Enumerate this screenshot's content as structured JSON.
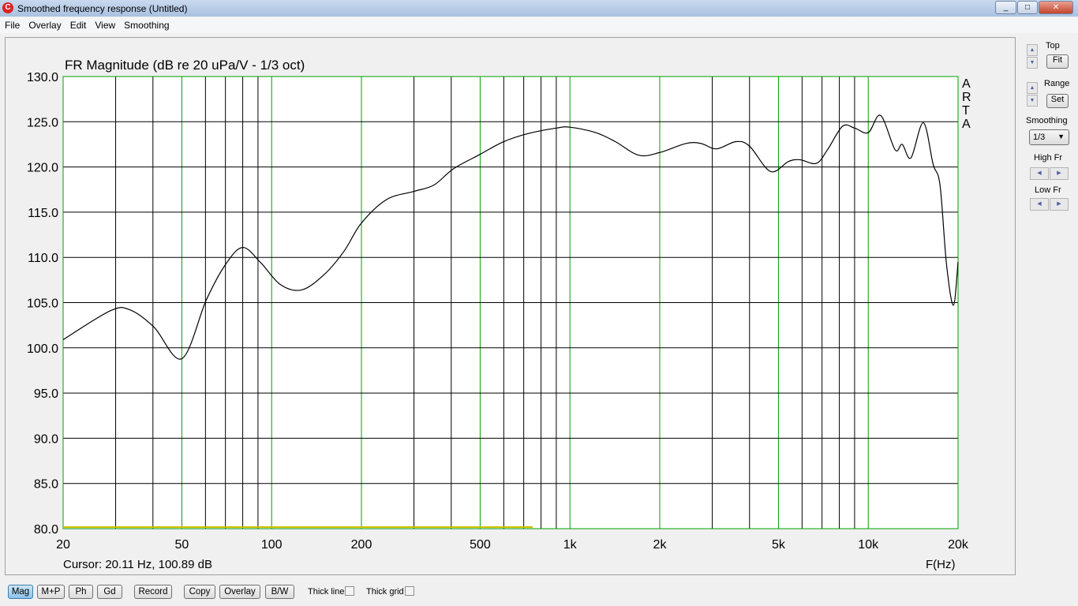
{
  "window": {
    "title": "Smoothed frequency response (Untitled)",
    "controls": [
      "_",
      "□",
      "✕"
    ]
  },
  "menu": [
    "File",
    "Overlay",
    "Edit",
    "View",
    "Smoothing"
  ],
  "side": {
    "top_label": "Top",
    "fit": "Fit",
    "range_label": "Range",
    "set": "Set",
    "smoothing_label": "Smoothing",
    "smoothing_value": "1/3",
    "high_fr": "High Fr",
    "low_fr": "Low Fr"
  },
  "bottom": {
    "buttons": [
      "Mag",
      "M+P",
      "Ph",
      "Gd",
      "Record",
      "Copy",
      "Overlay",
      "B/W"
    ],
    "active": "Mag",
    "thick_line": "Thick line",
    "thick_grid": "Thick grid",
    "thick_line_checked": false,
    "thick_grid_checked": false
  },
  "chart_data": {
    "type": "line",
    "title": "FR Magnitude (dB re 20 uPa/V - 1/3 oct)",
    "xlabel": "F(Hz)",
    "watermark": "ARTA",
    "cursor": "Cursor: 20.11 Hz, 100.89 dB",
    "xscale": "log",
    "xlim": [
      20,
      20000
    ],
    "ylim": [
      80,
      130
    ],
    "grid": true,
    "xticks": [
      {
        "v": 20,
        "l": "20"
      },
      {
        "v": 50,
        "l": "50"
      },
      {
        "v": 100,
        "l": "100"
      },
      {
        "v": 200,
        "l": "200"
      },
      {
        "v": 500,
        "l": "500"
      },
      {
        "v": 1000,
        "l": "1k"
      },
      {
        "v": 2000,
        "l": "2k"
      },
      {
        "v": 5000,
        "l": "5k"
      },
      {
        "v": 10000,
        "l": "10k"
      },
      {
        "v": 20000,
        "l": "20k"
      }
    ],
    "yticks": [
      "80.0",
      "85.0",
      "90.0",
      "95.0",
      "100.0",
      "105.0",
      "110.0",
      "115.0",
      "120.0",
      "125.0",
      "130.0"
    ],
    "colors": {
      "grid": "#00a000",
      "curve": "#000000",
      "background": "#ffffff",
      "baseline": "#d0c000"
    },
    "series": [
      {
        "x": [
          20,
          28.8,
          33.5,
          40.3,
          50,
          60.4,
          70,
          80,
          92,
          107,
          126,
          150,
          175,
          200,
          243,
          300,
          350,
          407,
          500,
          600,
          725,
          900,
          1000,
          1220,
          1420,
          1700,
          2000,
          2450,
          2750,
          3100,
          3600,
          4000,
          4700,
          5400,
          5900,
          6700,
          7300,
          8200,
          9000,
          10000,
          11000,
          12300,
          13000,
          13900,
          15300,
          16500,
          17400,
          18300,
          19300,
          20000
        ],
        "y": [
          100.9,
          104.1,
          104.2,
          102.3,
          98.8,
          105.3,
          109.2,
          111.1,
          109.4,
          107.0,
          106.4,
          108.1,
          110.7,
          113.8,
          116.4,
          117.3,
          118.0,
          119.8,
          121.4,
          122.8,
          123.7,
          124.3,
          124.4,
          123.8,
          122.8,
          121.3,
          121.6,
          122.6,
          122.6,
          122.0,
          122.8,
          122.3,
          119.5,
          120.6,
          120.8,
          120.4,
          121.9,
          124.5,
          124.3,
          123.8,
          125.7,
          121.9,
          122.5,
          121.0,
          124.9,
          120.3,
          118.0,
          109.2,
          104.7,
          109.5
        ]
      }
    ]
  }
}
